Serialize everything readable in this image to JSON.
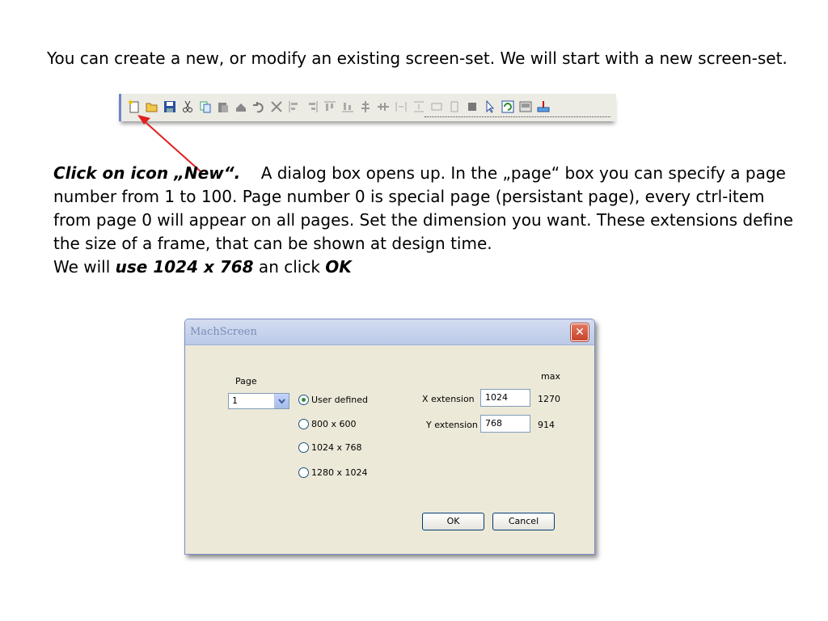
{
  "intro": "You can create a new, or modify an existing screen-set. We will start with a new screen-set.",
  "para": {
    "click_label": "Click on icon „New“.",
    "text1": "A dialog box opens up. In the „page“ box you can specify a page number from 1 to 100. Page number 0 is special page (persistant page), every ctrl-item from page 0 will appear on all pages. Set the dimension you want. These extensions define the size of a frame, that can be shown at design time.",
    "we_will": "We will ",
    "use_label": "use 1024 x 768",
    "an_click": " an click ",
    "ok_label": "OK"
  },
  "toolbar": {
    "icons": [
      "new-icon",
      "open-icon",
      "save-icon",
      "cut-icon",
      "copy-icon",
      "paste-icon",
      "paste-special-icon",
      "undo-icon",
      "delete-icon",
      "align-left-icon",
      "align-right-icon",
      "align-top-icon",
      "align-bottom-icon",
      "center-vertical-icon",
      "center-horizontal-icon",
      "space-horizontal-icon",
      "space-vertical-icon",
      "same-width-icon",
      "same-height-icon",
      "fill-icon",
      "pointer-icon",
      "refresh-icon",
      "screen-icon",
      "insert-icon"
    ]
  },
  "dialog": {
    "title": "MachScreen",
    "close": "✕",
    "page_label": "Page",
    "page_value": "1",
    "radios": [
      "User defined",
      "800 x 600",
      "1024 x 768",
      "1280 x 1024"
    ],
    "selected_radio": "User defined",
    "max_label": "max",
    "x_label": "X extension",
    "x_value": "1024",
    "x_max": "1270",
    "y_label": "Y extension",
    "y_value": "768",
    "y_max": "914",
    "ok": "OK",
    "cancel": "Cancel"
  },
  "colors": {
    "arrow": "#e02020",
    "titlebar": "#c8d4ee",
    "dialog_bg": "#ece9d8"
  }
}
